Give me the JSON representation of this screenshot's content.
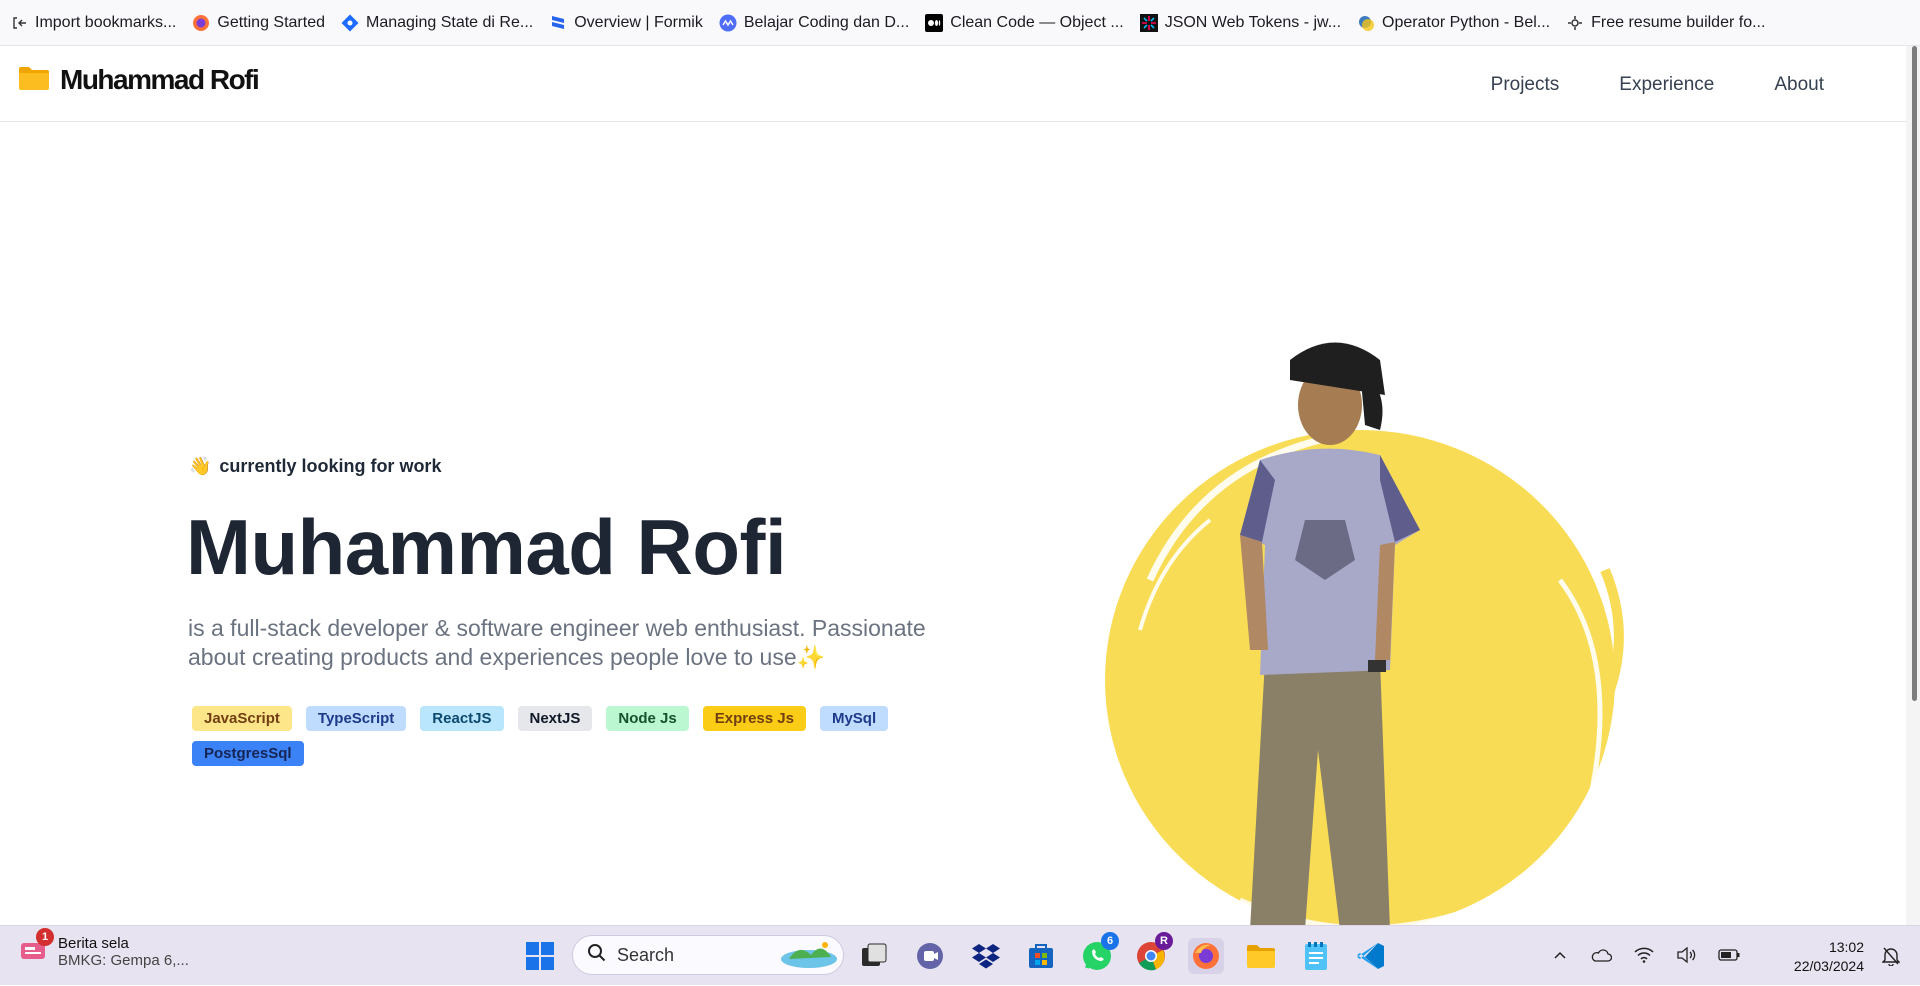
{
  "bookmarks": [
    {
      "label": "Import bookmarks...",
      "icon": "import-icon"
    },
    {
      "label": "Getting Started",
      "icon": "firefox-icon"
    },
    {
      "label": "Managing State di Re...",
      "icon": "diamond-icon"
    },
    {
      "label": "Overview | Formik",
      "icon": "formik-icon"
    },
    {
      "label": "Belajar Coding dan D...",
      "icon": "coding-icon"
    },
    {
      "label": "Clean Code — Object ...",
      "icon": "medium-icon"
    },
    {
      "label": "JSON Web Tokens - jw...",
      "icon": "jwt-icon"
    },
    {
      "label": "Operator Python - Bel...",
      "icon": "python-icon"
    },
    {
      "label": "Free resume builder fo...",
      "icon": "resume-icon"
    }
  ],
  "site": {
    "brand": "Muhammad Rofi",
    "nav": [
      "Projects",
      "Experience",
      "About"
    ]
  },
  "hero": {
    "status_emoji": "👋",
    "status": "currently looking for work",
    "title": "Muhammad Rofi",
    "description": "is a full-stack developer & software engineer web enthusiast. Passionate about creating products and experiences people love to use",
    "description_emoji": "✨",
    "tags": [
      {
        "label": "JavaScript",
        "bg": "#fde68a",
        "fg": "#713f12"
      },
      {
        "label": "TypeScript",
        "bg": "#bfdbfe",
        "fg": "#1e3a8a"
      },
      {
        "label": "ReactJS",
        "bg": "#bae6fd",
        "fg": "#0c4a6e"
      },
      {
        "label": "NextJS",
        "bg": "#e5e7eb",
        "fg": "#111827"
      },
      {
        "label": "Node Js",
        "bg": "#bbf7d0",
        "fg": "#14532d"
      },
      {
        "label": "Express Js",
        "bg": "#facc15",
        "fg": "#713f12"
      },
      {
        "label": "MySql",
        "bg": "#bfdbfe",
        "fg": "#1e3a8a"
      },
      {
        "label": "PostgresSql",
        "bg": "#3b82f6",
        "fg": "#172554"
      }
    ],
    "accent_yellow": "#f9dc56"
  },
  "taskbar": {
    "news_title": "Berita sela",
    "news_sub": "BMKG: Gempa 6,...",
    "news_badge": "1",
    "search_label": "Search",
    "whatsapp_badge": "6",
    "chrome_badge": "R",
    "time": "13:02",
    "date": "22/03/2024"
  }
}
